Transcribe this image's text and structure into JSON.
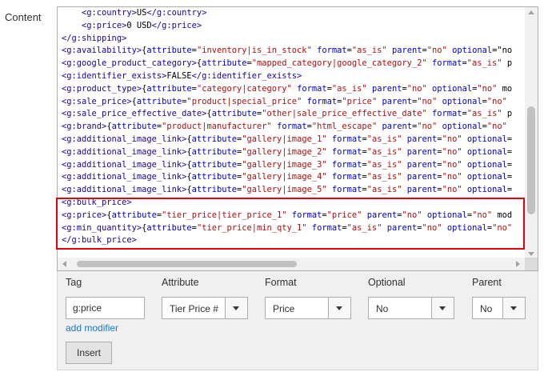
{
  "field_label": "Content",
  "code_lines": [
    {
      "indent": "    ",
      "parts": [
        {
          "t": "tag",
          "v": "<g:country>"
        },
        {
          "t": "txt",
          "v": "US"
        },
        {
          "t": "tag",
          "v": "</g:country>"
        }
      ]
    },
    {
      "indent": "    ",
      "parts": [
        {
          "t": "tag",
          "v": "<g:price>"
        },
        {
          "t": "txt",
          "v": "0 USD"
        },
        {
          "t": "tag",
          "v": "</g:price>"
        }
      ]
    },
    {
      "indent": "",
      "parts": [
        {
          "t": "tag",
          "v": "</g:shipping>"
        }
      ]
    },
    {
      "indent": "",
      "parts": [
        {
          "t": "tag",
          "v": "<g:availability>"
        },
        {
          "t": "txt",
          "v": "{"
        },
        {
          "t": "attr",
          "v": "attribute"
        },
        {
          "t": "txt",
          "v": "="
        },
        {
          "t": "str",
          "v": "\"inventory|is_in_stock\""
        },
        {
          "t": "txt",
          "v": " "
        },
        {
          "t": "attr",
          "v": "format"
        },
        {
          "t": "txt",
          "v": "="
        },
        {
          "t": "str",
          "v": "\"as_is\""
        },
        {
          "t": "txt",
          "v": " "
        },
        {
          "t": "attr",
          "v": "parent"
        },
        {
          "t": "txt",
          "v": "="
        },
        {
          "t": "str",
          "v": "\"no\""
        },
        {
          "t": "txt",
          "v": " "
        },
        {
          "t": "attr",
          "v": "optional"
        },
        {
          "t": "txt",
          "v": "=\"no"
        }
      ]
    },
    {
      "indent": "",
      "parts": [
        {
          "t": "tag",
          "v": "<g:google_product_category>"
        },
        {
          "t": "txt",
          "v": "{"
        },
        {
          "t": "attr",
          "v": "attribute"
        },
        {
          "t": "txt",
          "v": "="
        },
        {
          "t": "str",
          "v": "\"mapped_category|google_category_2\""
        },
        {
          "t": "txt",
          "v": " "
        },
        {
          "t": "attr",
          "v": "format"
        },
        {
          "t": "txt",
          "v": "="
        },
        {
          "t": "str",
          "v": "\"as_is\""
        },
        {
          "t": "txt",
          "v": " p"
        }
      ]
    },
    {
      "indent": "",
      "parts": [
        {
          "t": "tag",
          "v": "<g:identifier_exists>"
        },
        {
          "t": "txt",
          "v": "FALSE"
        },
        {
          "t": "tag",
          "v": "</g:identifier_exists>"
        }
      ]
    },
    {
      "indent": "",
      "parts": [
        {
          "t": "tag",
          "v": "<g:product_type>"
        },
        {
          "t": "txt",
          "v": "{"
        },
        {
          "t": "attr",
          "v": "attribute"
        },
        {
          "t": "txt",
          "v": "="
        },
        {
          "t": "str",
          "v": "\"category|category\""
        },
        {
          "t": "txt",
          "v": " "
        },
        {
          "t": "attr",
          "v": "format"
        },
        {
          "t": "txt",
          "v": "="
        },
        {
          "t": "str",
          "v": "\"as_is\""
        },
        {
          "t": "txt",
          "v": " "
        },
        {
          "t": "attr",
          "v": "parent"
        },
        {
          "t": "txt",
          "v": "="
        },
        {
          "t": "str",
          "v": "\"no\""
        },
        {
          "t": "txt",
          "v": " "
        },
        {
          "t": "attr",
          "v": "optional"
        },
        {
          "t": "txt",
          "v": "="
        },
        {
          "t": "str",
          "v": "\"no\""
        },
        {
          "t": "txt",
          "v": " mo"
        }
      ]
    },
    {
      "indent": "",
      "parts": [
        {
          "t": "tag",
          "v": "<g:sale_price>"
        },
        {
          "t": "txt",
          "v": "{"
        },
        {
          "t": "attr",
          "v": "attribute"
        },
        {
          "t": "txt",
          "v": "="
        },
        {
          "t": "str",
          "v": "\"product|special_price\""
        },
        {
          "t": "txt",
          "v": " "
        },
        {
          "t": "attr",
          "v": "format"
        },
        {
          "t": "txt",
          "v": "="
        },
        {
          "t": "str",
          "v": "\"price\""
        },
        {
          "t": "txt",
          "v": " "
        },
        {
          "t": "attr",
          "v": "parent"
        },
        {
          "t": "txt",
          "v": "="
        },
        {
          "t": "str",
          "v": "\"no\""
        },
        {
          "t": "txt",
          "v": " "
        },
        {
          "t": "attr",
          "v": "optional"
        },
        {
          "t": "txt",
          "v": "="
        },
        {
          "t": "str",
          "v": "\"no\""
        }
      ]
    },
    {
      "indent": "",
      "parts": [
        {
          "t": "tag",
          "v": "<g:sale_price_effective_date>"
        },
        {
          "t": "txt",
          "v": "{"
        },
        {
          "t": "attr",
          "v": "attribute"
        },
        {
          "t": "txt",
          "v": "="
        },
        {
          "t": "str",
          "v": "\"other|sale_price_effective_date\""
        },
        {
          "t": "txt",
          "v": " "
        },
        {
          "t": "attr",
          "v": "format"
        },
        {
          "t": "txt",
          "v": "="
        },
        {
          "t": "str",
          "v": "\"as_is\""
        },
        {
          "t": "txt",
          "v": " p"
        }
      ]
    },
    {
      "indent": "",
      "parts": [
        {
          "t": "tag",
          "v": "<g:brand>"
        },
        {
          "t": "txt",
          "v": "{"
        },
        {
          "t": "attr",
          "v": "attribute"
        },
        {
          "t": "txt",
          "v": "="
        },
        {
          "t": "str",
          "v": "\"product|manufacturer\""
        },
        {
          "t": "txt",
          "v": " "
        },
        {
          "t": "attr",
          "v": "format"
        },
        {
          "t": "txt",
          "v": "="
        },
        {
          "t": "str",
          "v": "\"html_escape\""
        },
        {
          "t": "txt",
          "v": " "
        },
        {
          "t": "attr",
          "v": "parent"
        },
        {
          "t": "txt",
          "v": "="
        },
        {
          "t": "str",
          "v": "\"no\""
        },
        {
          "t": "txt",
          "v": " "
        },
        {
          "t": "attr",
          "v": "optional"
        },
        {
          "t": "txt",
          "v": "="
        },
        {
          "t": "str",
          "v": "\"no\""
        }
      ]
    },
    {
      "indent": "",
      "parts": [
        {
          "t": "tag",
          "v": "<g:additional_image_link>"
        },
        {
          "t": "txt",
          "v": "{"
        },
        {
          "t": "attr",
          "v": "attribute"
        },
        {
          "t": "txt",
          "v": "="
        },
        {
          "t": "str",
          "v": "\"gallery|image_1\""
        },
        {
          "t": "txt",
          "v": " "
        },
        {
          "t": "attr",
          "v": "format"
        },
        {
          "t": "txt",
          "v": "="
        },
        {
          "t": "str",
          "v": "\"as_is\""
        },
        {
          "t": "txt",
          "v": " "
        },
        {
          "t": "attr",
          "v": "parent"
        },
        {
          "t": "txt",
          "v": "="
        },
        {
          "t": "str",
          "v": "\"no\""
        },
        {
          "t": "txt",
          "v": " "
        },
        {
          "t": "attr",
          "v": "optional"
        },
        {
          "t": "txt",
          "v": "="
        }
      ]
    },
    {
      "indent": "",
      "parts": [
        {
          "t": "tag",
          "v": "<g:additional_image_link>"
        },
        {
          "t": "txt",
          "v": "{"
        },
        {
          "t": "attr",
          "v": "attribute"
        },
        {
          "t": "txt",
          "v": "="
        },
        {
          "t": "str",
          "v": "\"gallery|image_2\""
        },
        {
          "t": "txt",
          "v": " "
        },
        {
          "t": "attr",
          "v": "format"
        },
        {
          "t": "txt",
          "v": "="
        },
        {
          "t": "str",
          "v": "\"as_is\""
        },
        {
          "t": "txt",
          "v": " "
        },
        {
          "t": "attr",
          "v": "parent"
        },
        {
          "t": "txt",
          "v": "="
        },
        {
          "t": "str",
          "v": "\"no\""
        },
        {
          "t": "txt",
          "v": " "
        },
        {
          "t": "attr",
          "v": "optional"
        },
        {
          "t": "txt",
          "v": "="
        }
      ]
    },
    {
      "indent": "",
      "parts": [
        {
          "t": "tag",
          "v": "<g:additional_image_link>"
        },
        {
          "t": "txt",
          "v": "{"
        },
        {
          "t": "attr",
          "v": "attribute"
        },
        {
          "t": "txt",
          "v": "="
        },
        {
          "t": "str",
          "v": "\"gallery|image_3\""
        },
        {
          "t": "txt",
          "v": " "
        },
        {
          "t": "attr",
          "v": "format"
        },
        {
          "t": "txt",
          "v": "="
        },
        {
          "t": "str",
          "v": "\"as_is\""
        },
        {
          "t": "txt",
          "v": " "
        },
        {
          "t": "attr",
          "v": "parent"
        },
        {
          "t": "txt",
          "v": "="
        },
        {
          "t": "str",
          "v": "\"no\""
        },
        {
          "t": "txt",
          "v": " "
        },
        {
          "t": "attr",
          "v": "optional"
        },
        {
          "t": "txt",
          "v": "="
        }
      ]
    },
    {
      "indent": "",
      "parts": [
        {
          "t": "tag",
          "v": "<g:additional_image_link>"
        },
        {
          "t": "txt",
          "v": "{"
        },
        {
          "t": "attr",
          "v": "attribute"
        },
        {
          "t": "txt",
          "v": "="
        },
        {
          "t": "str",
          "v": "\"gallery|image_4\""
        },
        {
          "t": "txt",
          "v": " "
        },
        {
          "t": "attr",
          "v": "format"
        },
        {
          "t": "txt",
          "v": "="
        },
        {
          "t": "str",
          "v": "\"as_is\""
        },
        {
          "t": "txt",
          "v": " "
        },
        {
          "t": "attr",
          "v": "parent"
        },
        {
          "t": "txt",
          "v": "="
        },
        {
          "t": "str",
          "v": "\"no\""
        },
        {
          "t": "txt",
          "v": " "
        },
        {
          "t": "attr",
          "v": "optional"
        },
        {
          "t": "txt",
          "v": "="
        }
      ]
    },
    {
      "indent": "",
      "parts": [
        {
          "t": "tag",
          "v": "<g:additional_image_link>"
        },
        {
          "t": "txt",
          "v": "{"
        },
        {
          "t": "attr",
          "v": "attribute"
        },
        {
          "t": "txt",
          "v": "="
        },
        {
          "t": "str",
          "v": "\"gallery|image_5\""
        },
        {
          "t": "txt",
          "v": " "
        },
        {
          "t": "attr",
          "v": "format"
        },
        {
          "t": "txt",
          "v": "="
        },
        {
          "t": "str",
          "v": "\"as_is\""
        },
        {
          "t": "txt",
          "v": " "
        },
        {
          "t": "attr",
          "v": "parent"
        },
        {
          "t": "txt",
          "v": "="
        },
        {
          "t": "str",
          "v": "\"no\""
        },
        {
          "t": "txt",
          "v": " "
        },
        {
          "t": "attr",
          "v": "optional"
        },
        {
          "t": "txt",
          "v": "="
        }
      ]
    },
    {
      "indent": "",
      "parts": [
        {
          "t": "tag",
          "v": "<g:bulk_price>"
        }
      ]
    },
    {
      "indent": "",
      "parts": [
        {
          "t": "tag",
          "v": "<g:price>"
        },
        {
          "t": "txt",
          "v": "{"
        },
        {
          "t": "attr",
          "v": "attribute"
        },
        {
          "t": "txt",
          "v": "="
        },
        {
          "t": "str",
          "v": "\"tier_price|tier_price_1\""
        },
        {
          "t": "txt",
          "v": " "
        },
        {
          "t": "attr",
          "v": "format"
        },
        {
          "t": "txt",
          "v": "="
        },
        {
          "t": "str",
          "v": "\"price\""
        },
        {
          "t": "txt",
          "v": " "
        },
        {
          "t": "attr",
          "v": "parent"
        },
        {
          "t": "txt",
          "v": "="
        },
        {
          "t": "str",
          "v": "\"no\""
        },
        {
          "t": "txt",
          "v": " "
        },
        {
          "t": "attr",
          "v": "optional"
        },
        {
          "t": "txt",
          "v": "="
        },
        {
          "t": "str",
          "v": "\"no\""
        },
        {
          "t": "txt",
          "v": " mod"
        }
      ]
    },
    {
      "indent": "",
      "parts": [
        {
          "t": "tag",
          "v": "<g:min_quantity>"
        },
        {
          "t": "txt",
          "v": "{"
        },
        {
          "t": "attr",
          "v": "attribute"
        },
        {
          "t": "txt",
          "v": "="
        },
        {
          "t": "str",
          "v": "\"tier_price|min_qty_1\""
        },
        {
          "t": "txt",
          "v": " "
        },
        {
          "t": "attr",
          "v": "format"
        },
        {
          "t": "txt",
          "v": "="
        },
        {
          "t": "str",
          "v": "\"as_is\""
        },
        {
          "t": "txt",
          "v": " "
        },
        {
          "t": "attr",
          "v": "parent"
        },
        {
          "t": "txt",
          "v": "="
        },
        {
          "t": "str",
          "v": "\"no\""
        },
        {
          "t": "txt",
          "v": " "
        },
        {
          "t": "attr",
          "v": "optional"
        },
        {
          "t": "txt",
          "v": "="
        },
        {
          "t": "str",
          "v": "\"no\""
        }
      ]
    },
    {
      "indent": "",
      "parts": [
        {
          "t": "tag",
          "v": "</g:bulk_price>"
        }
      ]
    }
  ],
  "colors": {
    "tag": "#170591",
    "highlight_border": "#e3000f",
    "link": "#1979c3"
  },
  "modifier": {
    "labels": {
      "tag": "Tag",
      "attribute": "Attribute",
      "format": "Format",
      "optional": "Optional",
      "parent": "Parent"
    },
    "tag_value": "g:price",
    "attribute_value": "Tier Price #",
    "format_value": "Price",
    "optional_value": "No",
    "parent_value": "No",
    "add_modifier": "add modifier",
    "insert": "Insert"
  }
}
